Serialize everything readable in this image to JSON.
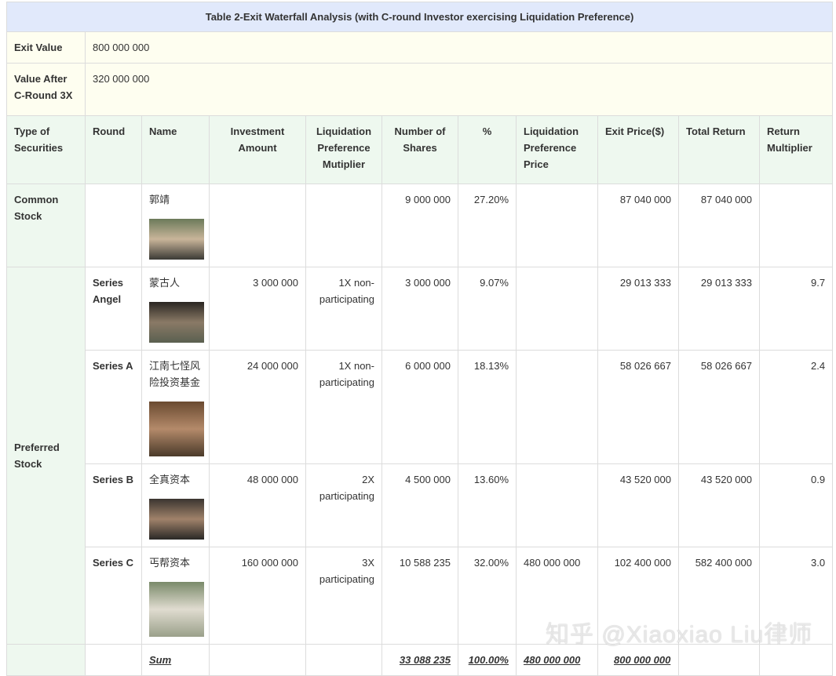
{
  "title": "Table 2-Exit Waterfall Analysis (with C-round Investor exercising Liquidation Preference)",
  "exit_value_label": "Exit Value",
  "exit_value": "800 000 000",
  "value_after_label": "Value After C-Round 3X",
  "value_after": "320 000 000",
  "headers": [
    "Type of Securities",
    "Round",
    "Name",
    "Investment Amount",
    "Liquidation Preference Mutiplier",
    "Number of Shares",
    "%",
    "Liquidation Preference Price",
    "Exit Price($)",
    "Total Return",
    "Return Multiplier"
  ],
  "common": {
    "type": "Common Stock",
    "name": "郭靖",
    "shares": "9 000 000",
    "pct": "27.20%",
    "exit": "87 040 000",
    "total": "87 040 000"
  },
  "preferred_label": "Preferred Stock",
  "rows": [
    {
      "round": "Series Angel",
      "name": "蒙古人",
      "inv": "3 000 000",
      "mult": "1X non-participating",
      "shares": "3 000 000",
      "pct": "9.07%",
      "lpp": "",
      "exit": "29 013 333",
      "total": "29 013 333",
      "ret": "9.7"
    },
    {
      "round": "Series A",
      "name": "江南七怪风险投资基金",
      "inv": "24 000 000",
      "mult": "1X non-participating",
      "shares": "6 000 000",
      "pct": "18.13%",
      "lpp": "",
      "exit": "58 026 667",
      "total": "58 026 667",
      "ret": "2.4"
    },
    {
      "round": "Series B",
      "name": "全真资本",
      "inv": "48 000 000",
      "mult": "2X participating",
      "shares": "4 500 000",
      "pct": "13.60%",
      "lpp": "",
      "exit": "43 520 000",
      "total": "43 520 000",
      "ret": "0.9"
    },
    {
      "round": "Series C",
      "name": "丐帮资本",
      "inv": "160 000 000",
      "mult": "3X participating",
      "shares": "10 588 235",
      "pct": "32.00%",
      "lpp": "480 000 000",
      "exit": "102 400 000",
      "total": "582 400 000",
      "ret": "3.0"
    }
  ],
  "sum": {
    "label": "Sum",
    "shares": "33 088 235",
    "pct": "100.00%",
    "lpp": "480 000 000",
    "exit": "800 000 000"
  },
  "watermark": "知乎 @Xiaoxiao Liu律师",
  "colors": {
    "title_bg": "#e1e9fb",
    "yellow_bg": "#fefef0",
    "green_bg": "#eef8ef"
  }
}
